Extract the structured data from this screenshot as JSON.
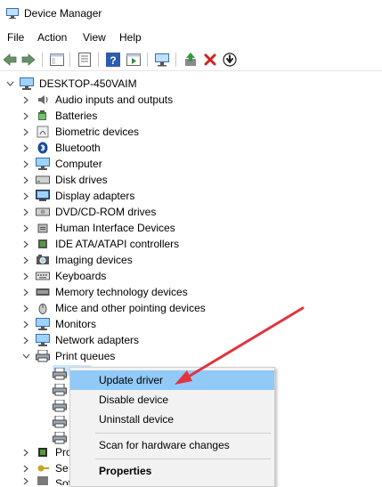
{
  "window": {
    "title": "Device Manager"
  },
  "menu": [
    "File",
    "Action",
    "View",
    "Help"
  ],
  "tree": {
    "root": "DESKTOP-450VAIM",
    "categories": [
      "Audio inputs and outputs",
      "Batteries",
      "Biometric devices",
      "Bluetooth",
      "Computer",
      "Disk drives",
      "Display adapters",
      "DVD/CD-ROM drives",
      "Human Interface Devices",
      "IDE ATA/ATAPI controllers",
      "Imaging devices",
      "Keyboards",
      "Memory technology devices",
      "Mice and other pointing devices",
      "Monitors",
      "Network adapters",
      "Print queues"
    ],
    "partial": [
      "Pro",
      "Se",
      "Software devices"
    ]
  },
  "context_menu": {
    "update": "Update driver",
    "disable": "Disable device",
    "uninstall": "Uninstall device",
    "scan": "Scan for hardware changes",
    "properties": "Properties"
  },
  "colors": {
    "highlight": "#91c9f7",
    "arrow": "#e0343f",
    "menu_bg": "#f2f2f2"
  }
}
